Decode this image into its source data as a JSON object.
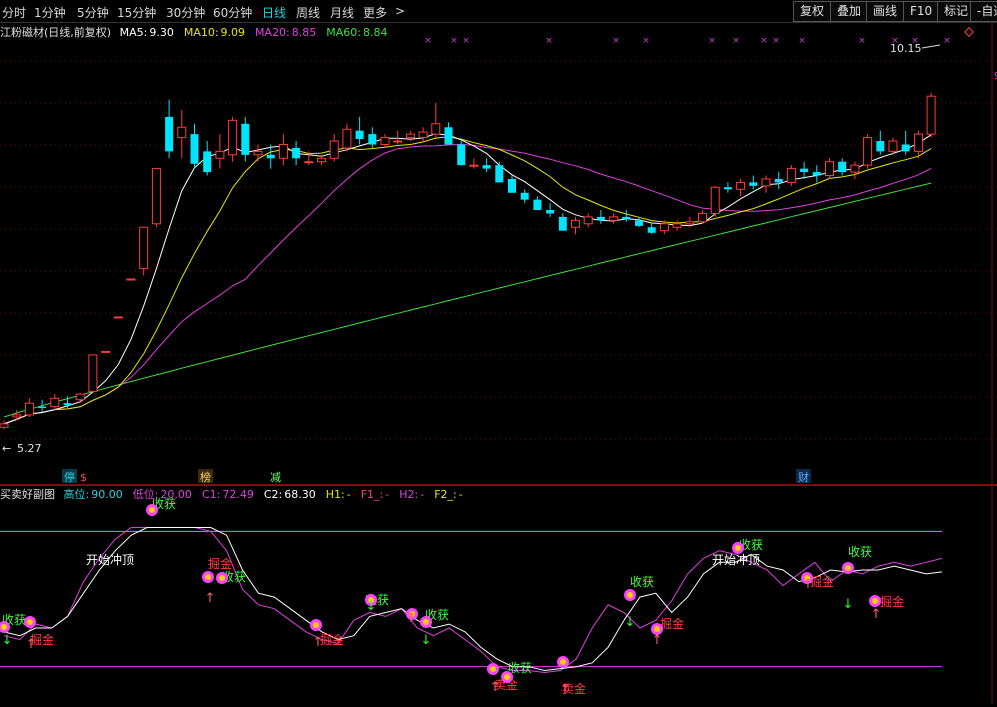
{
  "toolbar": {
    "timeframes": [
      "分时",
      "1分钟",
      "5分钟",
      "15分钟",
      "30分钟",
      "60分钟",
      "日线",
      "周线",
      "月线",
      "更多"
    ],
    "more_arrow": ">",
    "active": "日线",
    "right_buttons": [
      "复权",
      "叠加",
      "画线",
      "F10",
      "标记",
      "-自选"
    ]
  },
  "main": {
    "stock_title": "江粉磁材(日线,前复权)",
    "ma": [
      {
        "label": "MA5:",
        "value": "9.30",
        "color": "#ffffff"
      },
      {
        "label": "MA10:",
        "value": "9.09",
        "color": "#e6e600"
      },
      {
        "label": "MA20:",
        "value": "8.85",
        "color": "#e040e0"
      },
      {
        "label": "MA60:",
        "value": "8.84",
        "color": "#40e040"
      }
    ],
    "high_label": "10.15",
    "low_label": "5.27",
    "right_edge_label": "9",
    "markers": [
      {
        "text": "停",
        "color": "#2fd0e0",
        "bg": "#0b3b4a"
      },
      {
        "text": "$",
        "color": "#ff4040",
        "bg": ""
      },
      {
        "text": "榜",
        "color": "#ffcc66",
        "bg": "#3a2a10"
      },
      {
        "text": "减",
        "color": "#66ff66",
        "bg": ""
      },
      {
        "text": "财",
        "color": "#66aaff",
        "bg": "#0d2a4a"
      }
    ]
  },
  "sub": {
    "title": "买卖好副图",
    "params": [
      {
        "label": "高位:",
        "value": "90.00",
        "color": "#2fd0e0"
      },
      {
        "label": "低位:",
        "value": "20.00",
        "color": "#e040e0"
      },
      {
        "label": "C1:",
        "value": "72.49",
        "color": "#e040e0"
      },
      {
        "label": "C2:",
        "value": "68.30",
        "color": "#ffffff"
      },
      {
        "label": "H1:",
        "value": "-",
        "color": "#e6e600"
      },
      {
        "label": "F1_:",
        "value": "-",
        "color": "#ff4080"
      },
      {
        "label": "H2:",
        "value": "-",
        "color": "#e040e0"
      },
      {
        "label": "F2_:",
        "value": "-",
        "color": "#e6e600"
      }
    ],
    "annotations": {
      "start_top": "开始冲顶",
      "harvest": "收获",
      "dig_gold": "掘金",
      "sell": "卖金"
    }
  },
  "chart_data": {
    "type": "candlestick",
    "title": "江粉磁材(日线,前复权)",
    "series_shown": [
      "MA5",
      "MA10",
      "MA20",
      "MA60"
    ],
    "ma_latest": {
      "MA5": 9.3,
      "MA10": 9.09,
      "MA20": 8.85,
      "MA60": 8.84
    },
    "price_high": 10.15,
    "price_low": 5.27,
    "candles_ohlc": [
      [
        5.3,
        5.4,
        5.27,
        5.35
      ],
      [
        5.45,
        5.55,
        5.4,
        5.48
      ],
      [
        5.48,
        5.72,
        5.45,
        5.65
      ],
      [
        5.6,
        5.7,
        5.52,
        5.58
      ],
      [
        5.6,
        5.78,
        5.55,
        5.72
      ],
      [
        5.65,
        5.75,
        5.58,
        5.62
      ],
      [
        5.7,
        5.8,
        5.65,
        5.78
      ],
      [
        5.82,
        6.35,
        5.8,
        6.35
      ],
      [
        6.4,
        6.4,
        6.4,
        6.4
      ],
      [
        6.9,
        6.9,
        6.9,
        6.9
      ],
      [
        7.45,
        7.45,
        7.45,
        7.45
      ],
      [
        7.6,
        8.2,
        7.5,
        8.2
      ],
      [
        8.25,
        9.05,
        8.2,
        9.05
      ],
      [
        9.8,
        10.05,
        9.2,
        9.3
      ],
      [
        9.5,
        9.9,
        9.2,
        9.65
      ],
      [
        9.55,
        9.7,
        9.05,
        9.12
      ],
      [
        9.3,
        9.45,
        8.95,
        9.0
      ],
      [
        9.2,
        9.55,
        9.05,
        9.3
      ],
      [
        9.25,
        9.8,
        9.15,
        9.75
      ],
      [
        9.7,
        9.8,
        9.15,
        9.25
      ],
      [
        9.25,
        9.4,
        9.15,
        9.3
      ],
      [
        9.25,
        9.4,
        9.05,
        9.2
      ],
      [
        9.2,
        9.55,
        9.1,
        9.4
      ],
      [
        9.35,
        9.45,
        9.1,
        9.2
      ],
      [
        9.15,
        9.3,
        9.1,
        9.15
      ],
      [
        9.15,
        9.25,
        9.1,
        9.2
      ],
      [
        9.2,
        9.55,
        9.15,
        9.45
      ],
      [
        9.35,
        9.7,
        9.3,
        9.62
      ],
      [
        9.6,
        9.8,
        9.4,
        9.48
      ],
      [
        9.55,
        9.65,
        9.35,
        9.4
      ],
      [
        9.4,
        9.55,
        9.35,
        9.5
      ],
      [
        9.45,
        9.6,
        9.4,
        9.45
      ],
      [
        9.5,
        9.6,
        9.45,
        9.55
      ],
      [
        9.5,
        9.65,
        9.45,
        9.58
      ],
      [
        9.55,
        10.0,
        9.5,
        9.7
      ],
      [
        9.65,
        9.72,
        9.4,
        9.4
      ],
      [
        9.4,
        9.45,
        9.1,
        9.1
      ],
      [
        9.1,
        9.2,
        9.05,
        9.1
      ],
      [
        9.1,
        9.2,
        9.0,
        9.05
      ],
      [
        9.1,
        9.15,
        8.85,
        8.85
      ],
      [
        8.9,
        8.95,
        8.7,
        8.7
      ],
      [
        8.7,
        8.75,
        8.55,
        8.6
      ],
      [
        8.6,
        8.65,
        8.45,
        8.45
      ],
      [
        8.45,
        8.55,
        8.35,
        8.4
      ],
      [
        8.35,
        8.4,
        8.15,
        8.15
      ],
      [
        8.2,
        8.35,
        8.1,
        8.3
      ],
      [
        8.25,
        8.4,
        8.2,
        8.35
      ],
      [
        8.35,
        8.45,
        8.25,
        8.3
      ],
      [
        8.3,
        8.4,
        8.25,
        8.35
      ],
      [
        8.35,
        8.45,
        8.28,
        8.32
      ],
      [
        8.3,
        8.35,
        8.2,
        8.22
      ],
      [
        8.2,
        8.25,
        8.1,
        8.12
      ],
      [
        8.15,
        8.3,
        8.1,
        8.25
      ],
      [
        8.2,
        8.3,
        8.15,
        8.25
      ],
      [
        8.25,
        8.35,
        8.2,
        8.28
      ],
      [
        8.28,
        8.45,
        8.25,
        8.4
      ],
      [
        8.4,
        8.8,
        8.35,
        8.78
      ],
      [
        8.78,
        8.85,
        8.7,
        8.75
      ],
      [
        8.75,
        8.9,
        8.65,
        8.85
      ],
      [
        8.85,
        8.95,
        8.75,
        8.8
      ],
      [
        8.8,
        8.95,
        8.7,
        8.9
      ],
      [
        8.9,
        9.0,
        8.75,
        8.85
      ],
      [
        8.85,
        9.1,
        8.8,
        9.05
      ],
      [
        9.05,
        9.15,
        8.9,
        9.0
      ],
      [
        9.0,
        9.1,
        8.85,
        8.95
      ],
      [
        8.95,
        9.2,
        8.9,
        9.15
      ],
      [
        9.15,
        9.2,
        8.95,
        9.0
      ],
      [
        9.0,
        9.15,
        8.9,
        9.1
      ],
      [
        9.1,
        9.55,
        9.05,
        9.5
      ],
      [
        9.45,
        9.6,
        9.25,
        9.3
      ],
      [
        9.3,
        9.5,
        9.25,
        9.45
      ],
      [
        9.4,
        9.6,
        9.25,
        9.3
      ],
      [
        9.3,
        9.6,
        9.2,
        9.55
      ],
      [
        9.55,
        10.15,
        9.5,
        10.1
      ]
    ],
    "indicator_levels": {
      "high": 90.0,
      "low": 20.0
    },
    "indicator_latest": {
      "C1": 72.49,
      "C2": 68.3
    }
  }
}
